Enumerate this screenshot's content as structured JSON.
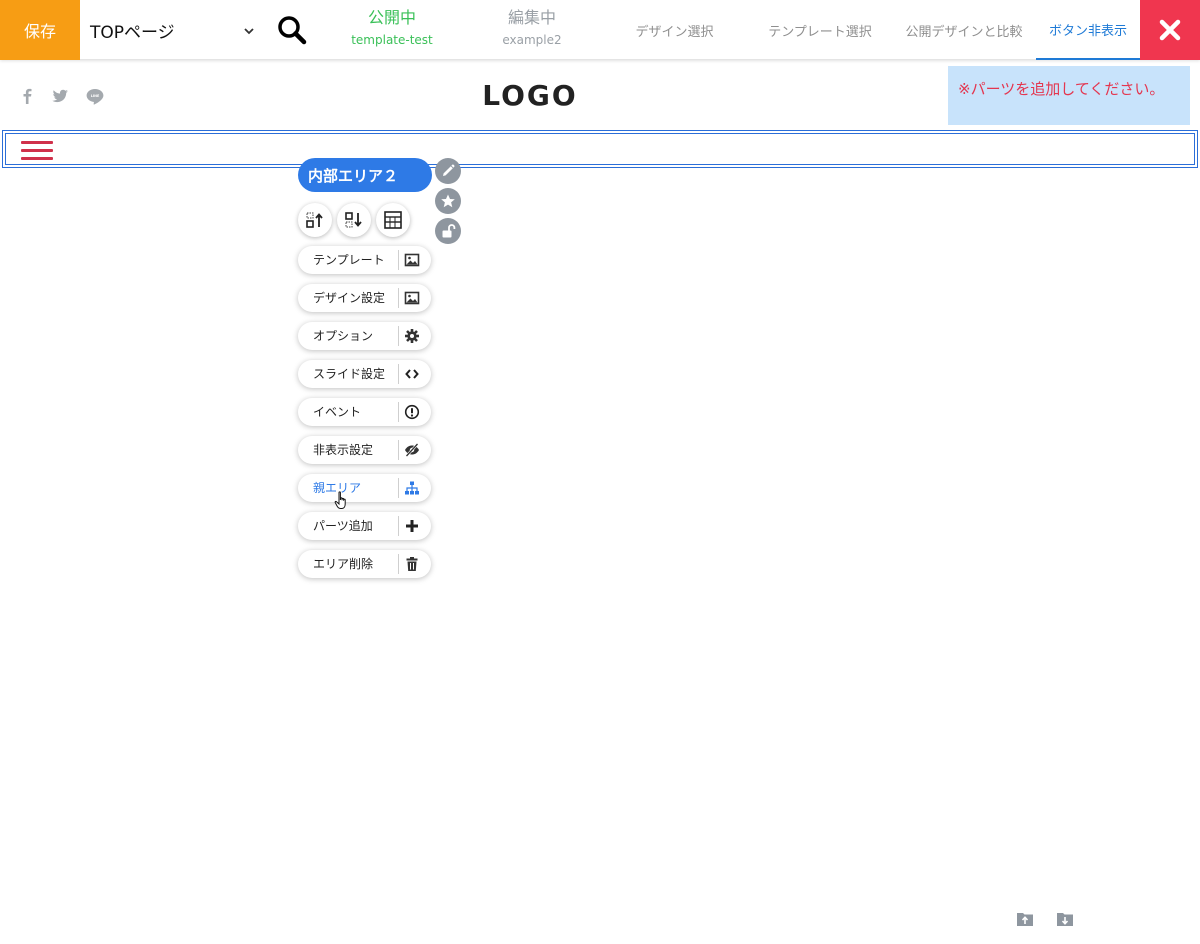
{
  "toolbar": {
    "save_label": "保存",
    "page_select_value": "TOPページ",
    "public_status": {
      "label": "公開中",
      "design": "template-test"
    },
    "editing_status": {
      "label": "編集中",
      "design": "example2"
    },
    "links": [
      "デザイン選択",
      "テンプレート選択",
      "公開デザインと比較",
      "ボタン非表示"
    ],
    "active_link": "ボタン非表示",
    "colors": {
      "save": "#f79d14",
      "public": "#3ac058",
      "active": "#1e7ad6",
      "close": "#f0364f"
    }
  },
  "header": {
    "logo": "LOGO",
    "social_icons": [
      "facebook-icon",
      "twitter-icon",
      "line-icon"
    ],
    "notice": "※パーツを追加してください。"
  },
  "area_menu": {
    "title": "内部エリア２",
    "side_icons": [
      "pencil-icon",
      "star-icon",
      "unlock-icon"
    ],
    "tool_icons": [
      "move-up-icon",
      "move-down-icon",
      "layout-icon"
    ],
    "items": [
      {
        "label": "テンプレート",
        "icon": "image-icon"
      },
      {
        "label": "デザイン設定",
        "icon": "image-icon"
      },
      {
        "label": "オプション",
        "icon": "gear-icon"
      },
      {
        "label": "スライド設定",
        "icon": "code-icon"
      },
      {
        "label": "イベント",
        "icon": "alert-circle-icon"
      },
      {
        "label": "非表示設定",
        "icon": "eye-slash-icon"
      },
      {
        "label": "親エリア",
        "icon": "sitemap-icon"
      },
      {
        "label": "パーツ追加",
        "icon": "plus-icon"
      },
      {
        "label": "エリア削除",
        "icon": "trash-icon"
      }
    ],
    "active_item": "親エリア"
  }
}
